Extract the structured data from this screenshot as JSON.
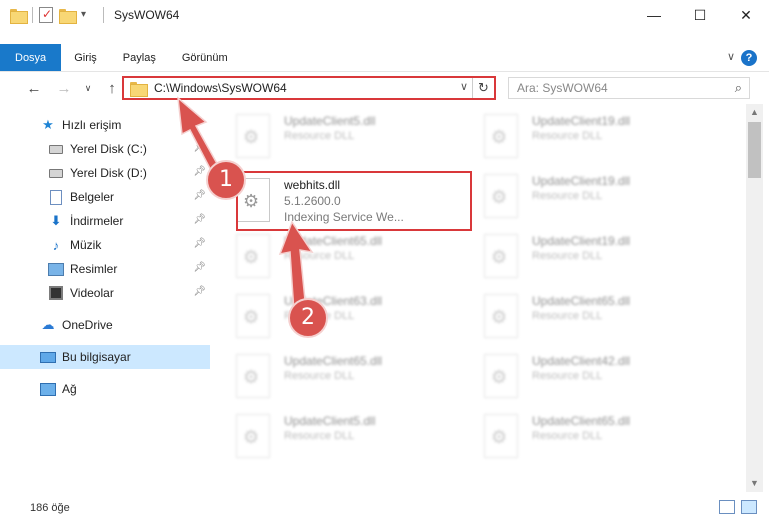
{
  "window": {
    "title": "SysWOW64",
    "minimize": "—",
    "maximize": "☐",
    "close": "✕"
  },
  "ribbon": {
    "tabs": [
      "Dosya",
      "Giriş",
      "Paylaş",
      "Görünüm"
    ],
    "help": "?",
    "collapse": "∨"
  },
  "nav": {
    "back": "←",
    "forward": "→",
    "recent": "∨",
    "up": "↑",
    "address": "C:\\Windows\\SysWOW64",
    "address_dropdown": "∨",
    "refresh": "↻",
    "search_placeholder": "Ara: SysWOW64",
    "search_icon": "⌕"
  },
  "sidebar": {
    "quick_access": "Hızlı erişim",
    "items": [
      {
        "label": "Yerel Disk (C:)",
        "icon": "drive-icon"
      },
      {
        "label": "Yerel Disk (D:)",
        "icon": "drive-icon"
      },
      {
        "label": "Belgeler",
        "icon": "documents-icon"
      },
      {
        "label": "İndirmeler",
        "icon": "downloads-icon"
      },
      {
        "label": "Müzik",
        "icon": "music-icon"
      },
      {
        "label": "Resimler",
        "icon": "pictures-icon"
      },
      {
        "label": "Videolar",
        "icon": "videos-icon"
      }
    ],
    "onedrive": "OneDrive",
    "this_pc": "Bu bilgisayar",
    "network": "Ağ"
  },
  "files": {
    "highlighted": {
      "name": "webhits.dll",
      "version": "5.1.2600.0",
      "description": "Indexing Service We..."
    },
    "left_column": [
      {
        "name": "UpdateClient5.dll",
        "desc": "Resource DLL"
      },
      {
        "name": "UpdateClient65.dll",
        "desc": "Resource DLL"
      },
      {
        "name": "UpdateClient63.dll",
        "desc": "Resource DLL"
      },
      {
        "name": "UpdateClient65.dll",
        "desc": "Resource DLL"
      },
      {
        "name": "UpdateClient5.dll",
        "desc": "Resource DLL"
      }
    ],
    "right_column": [
      {
        "name": "UpdateClient19.dll",
        "desc": "Resource DLL"
      },
      {
        "name": "UpdateClient19.dll",
        "desc": "Resource DLL"
      },
      {
        "name": "UpdateClient19.dll",
        "desc": "Resource DLL"
      },
      {
        "name": "UpdateClient65.dll",
        "desc": "Resource DLL"
      },
      {
        "name": "UpdateClient42.dll",
        "desc": "Resource DLL"
      },
      {
        "name": "UpdateClient65.dll",
        "desc": "Resource DLL"
      }
    ]
  },
  "status": {
    "count": "186 öğe"
  },
  "callouts": [
    "1",
    "2"
  ],
  "colors": {
    "accent": "#1979ca",
    "highlight_red": "#d9383a",
    "callout_red": "#d9534f",
    "selected_bg": "#cce8ff"
  }
}
